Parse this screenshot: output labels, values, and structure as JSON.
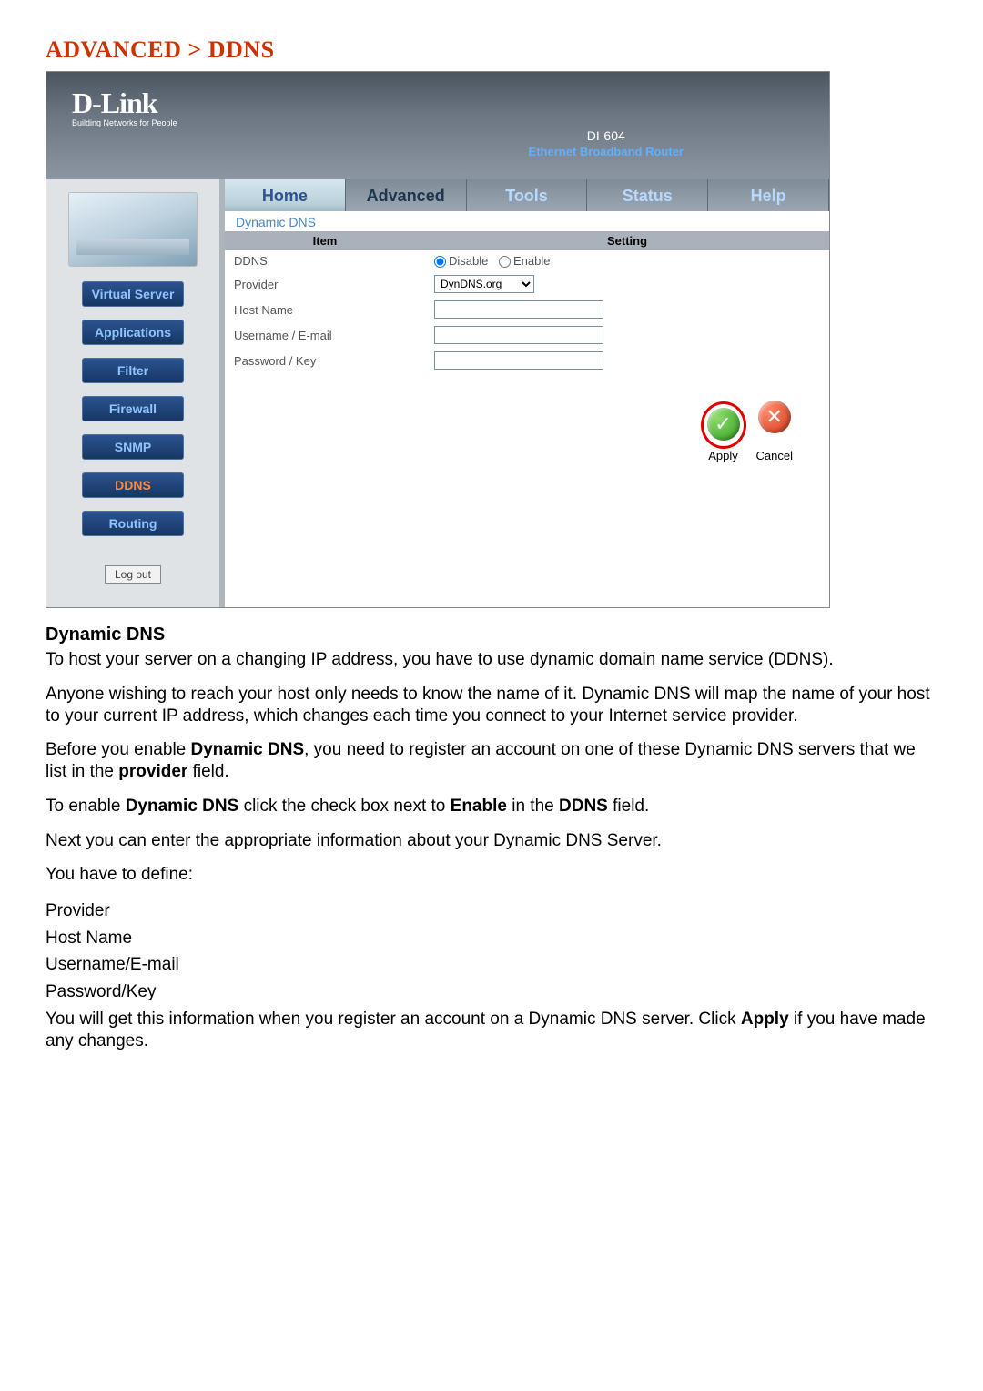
{
  "page": {
    "title": "ADVANCED > DDNS"
  },
  "router": {
    "brand": "D-Link",
    "tagline": "Building Networks for People",
    "model": "DI-604",
    "model_desc": "Ethernet Broadband Router"
  },
  "tabs": {
    "home": "Home",
    "advanced": "Advanced",
    "tools": "Tools",
    "status": "Status",
    "help": "Help"
  },
  "sidebar": {
    "items": [
      "Virtual Server",
      "Applications",
      "Filter",
      "Firewall",
      "SNMP",
      "DDNS",
      "Routing"
    ],
    "logout": "Log out"
  },
  "panel": {
    "subheader": "Dynamic DNS",
    "col_item": "Item",
    "col_setting": "Setting",
    "row_ddns": "DDNS",
    "opt_disable": "Disable",
    "opt_enable": "Enable",
    "row_provider": "Provider",
    "provider_selected": "DynDNS.org",
    "row_host": "Host Name",
    "row_user": "Username / E-mail",
    "row_pass": "Password / Key",
    "form": {
      "host": "",
      "user": "",
      "pass": ""
    },
    "apply": "Apply",
    "cancel": "Cancel"
  },
  "doc": {
    "heading": "Dynamic DNS",
    "p1": "To host your server on a changing IP address, you have to use dynamic domain name service (DDNS).",
    "p2": "Anyone wishing to reach your host only needs to know the name of it. Dynamic DNS will map the name of your host to your current IP address, which changes each time you connect to your Internet service provider.",
    "p3a": "Before you enable ",
    "p3b": "Dynamic DNS",
    "p3c": ", you need to register an account on one of these Dynamic DNS servers that we list in the ",
    "p3d": "provider",
    "p3e": " field.",
    "p4a": "To enable ",
    "p4b": "Dynamic DNS",
    "p4c": " click the check box next to ",
    "p4d": "Enable",
    "p4e": " in the ",
    "p4f": "DDNS",
    "p4g": " field.",
    "p5": "Next you can enter the appropriate information about your Dynamic DNS Server.",
    "p6": "You have to define:",
    "def1": "Provider",
    "def2": "Host Name",
    "def3": "Username/E-mail",
    "def4": "Password/Key",
    "p7a": "You will get this information when you register an account on a Dynamic DNS server. Click ",
    "p7b": "Apply",
    "p7c": " if you have made any changes."
  }
}
